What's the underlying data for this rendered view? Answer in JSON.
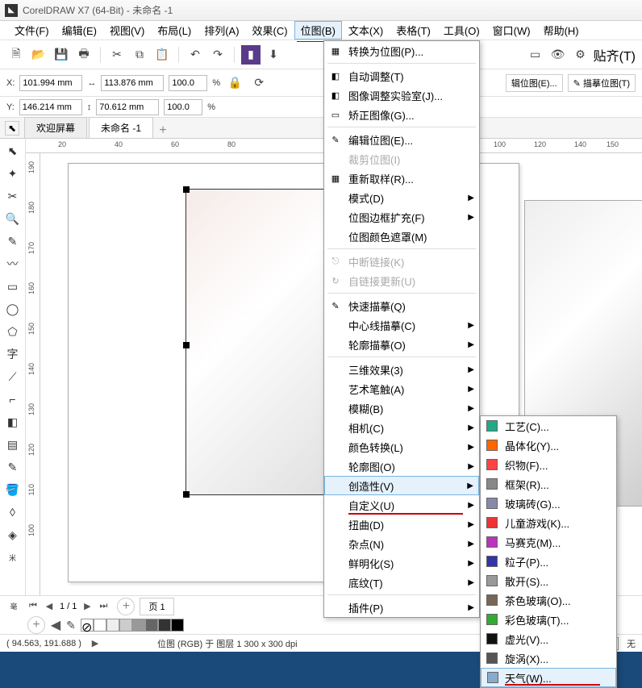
{
  "title": "CorelDRAW X7 (64-Bit) - 未命名 -1",
  "menus": [
    "文件(F)",
    "编辑(E)",
    "视图(V)",
    "布局(L)",
    "排列(A)",
    "效果(C)",
    "位图(B)",
    "文本(X)",
    "表格(T)",
    "工具(O)",
    "窗口(W)",
    "帮助(H)"
  ],
  "toolbar_right": "贴齐(T)",
  "prop": {
    "x_label": "X:",
    "x": "101.994 mm",
    "y_label": "Y:",
    "y": "146.214 mm",
    "w": "113.876 mm",
    "h": "70.612 mm",
    "sx": "100.0",
    "sy": "100.0",
    "pct": "%",
    "btn_edit": "辑位图(E)...",
    "btn_trace": "描摹位图(T)"
  },
  "tabs": {
    "t1": "欢迎屏幕",
    "t2": "未命名 -1"
  },
  "hruler": [
    "20",
    "40",
    "60",
    "80",
    "100",
    "120",
    "140",
    "150"
  ],
  "vruler": [
    "190",
    "180",
    "170",
    "160",
    "150",
    "140",
    "130",
    "120",
    "110",
    "100"
  ],
  "pager": {
    "pos": "1 / 1",
    "page": "页 1"
  },
  "status": {
    "coords": "( 94.563, 191.688 )",
    "info": "位图 (RGB) 于 图层 1 300 x 300 dpi",
    "none": "无"
  },
  "menu1": [
    {
      "t": "转换为位图(P)...",
      "i": "▦"
    },
    {
      "sep": 1
    },
    {
      "t": "自动调整(T)",
      "i": "◧"
    },
    {
      "t": "图像调整实验室(J)...",
      "i": "◧"
    },
    {
      "t": "矫正图像(G)...",
      "i": "▭"
    },
    {
      "sep": 1
    },
    {
      "t": "编辑位图(E)...",
      "i": "✎"
    },
    {
      "t": "裁剪位图(I)",
      "dis": 1
    },
    {
      "t": "重新取样(R)...",
      "i": "▦"
    },
    {
      "t": "模式(D)",
      "sub": 1
    },
    {
      "t": "位图边框扩充(F)",
      "sub": 1
    },
    {
      "t": "位图颜色遮罩(M)"
    },
    {
      "sep": 1
    },
    {
      "t": "中断链接(K)",
      "dis": 1,
      "i": "⎋"
    },
    {
      "t": "自链接更新(U)",
      "dis": 1,
      "i": "↻"
    },
    {
      "sep": 1
    },
    {
      "t": "快速描摹(Q)",
      "i": "✎"
    },
    {
      "t": "中心线描摹(C)",
      "sub": 1
    },
    {
      "t": "轮廓描摹(O)",
      "sub": 1
    },
    {
      "sep": 1
    },
    {
      "t": "三维效果(3)",
      "sub": 1
    },
    {
      "t": "艺术笔触(A)",
      "sub": 1
    },
    {
      "t": "模糊(B)",
      "sub": 1
    },
    {
      "t": "相机(C)",
      "sub": 1
    },
    {
      "t": "颜色转换(L)",
      "sub": 1
    },
    {
      "t": "轮廓图(O)",
      "sub": 1
    },
    {
      "t": "创造性(V)",
      "sub": 1,
      "hl": 1
    },
    {
      "t": "自定义(U)",
      "sub": 1
    },
    {
      "t": "扭曲(D)",
      "sub": 1
    },
    {
      "t": "杂点(N)",
      "sub": 1
    },
    {
      "t": "鲜明化(S)",
      "sub": 1
    },
    {
      "t": "底纹(T)",
      "sub": 1
    },
    {
      "sep": 1
    },
    {
      "t": "插件(P)",
      "sub": 1
    }
  ],
  "menu2": [
    {
      "t": "工艺(C)...",
      "c": "#2a8"
    },
    {
      "t": "晶体化(Y)...",
      "c": "#f60"
    },
    {
      "t": "织物(F)...",
      "c": "#f44"
    },
    {
      "t": "框架(R)...",
      "c": "#888"
    },
    {
      "t": "玻璃砖(G)...",
      "c": "#88a"
    },
    {
      "t": "儿童游戏(K)...",
      "c": "#e33"
    },
    {
      "t": "马赛克(M)...",
      "c": "#b3b"
    },
    {
      "t": "粒子(P)...",
      "c": "#33a"
    },
    {
      "t": "散开(S)...",
      "c": "#999"
    },
    {
      "t": "茶色玻璃(O)...",
      "c": "#765"
    },
    {
      "t": "彩色玻璃(T)...",
      "c": "#3a3"
    },
    {
      "t": "虚光(V)...",
      "c": "#111"
    },
    {
      "t": "旋涡(X)...",
      "c": "#555"
    },
    {
      "t": "天气(W)...",
      "c": "#8ac",
      "hl": 1
    }
  ],
  "palette": [
    "#fff",
    "#eee",
    "#ccc",
    "#999",
    "#666",
    "#333",
    "#000"
  ]
}
